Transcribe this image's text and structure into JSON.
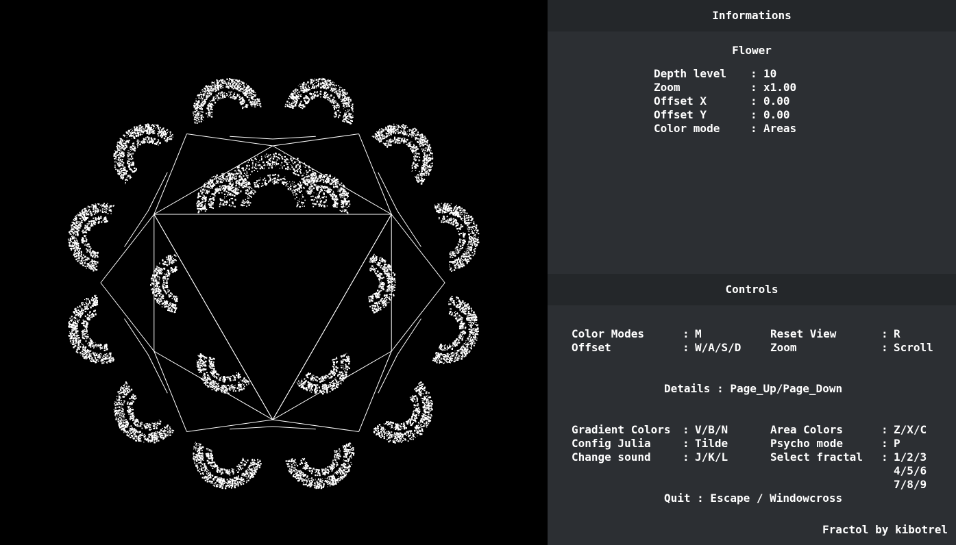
{
  "info": {
    "header": "Informations",
    "fractal_name": "Flower",
    "rows": [
      {
        "label": "Depth level",
        "value": "10"
      },
      {
        "label": "Zoom",
        "value": "x1.00"
      },
      {
        "label": "Offset X",
        "value": "0.00"
      },
      {
        "label": "Offset Y",
        "value": "0.00"
      },
      {
        "label": "Color mode",
        "value": "Areas"
      }
    ]
  },
  "controls": {
    "header": "Controls",
    "left": [
      {
        "label": "Color Modes",
        "keys": "M"
      },
      {
        "label": "Offset",
        "keys": "W/A/S/D"
      }
    ],
    "right": [
      {
        "label": "Reset View",
        "keys": "R"
      },
      {
        "label": "Zoom",
        "keys": "Scroll"
      }
    ],
    "details": "Details : Page_Up/Page_Down",
    "left2": [
      {
        "label": "Gradient Colors",
        "keys": "V/B/N"
      },
      {
        "label": "Config Julia",
        "keys": "Tilde"
      },
      {
        "label": "Change sound",
        "keys": "J/K/L"
      }
    ],
    "right2": [
      {
        "label": "Area Colors",
        "keys": "Z/X/C"
      },
      {
        "label": "Psycho mode",
        "keys": "P"
      },
      {
        "label": "Select fractal",
        "keys": "1/2/3"
      }
    ],
    "select_more": [
      "4/5/6",
      "7/8/9"
    ],
    "quit": "Quit : Escape / Windowcross"
  },
  "credit": "Fractol by kibotrel",
  "colors": {
    "panel_bg": "#2c2f33",
    "header_bg": "#24272a",
    "fractal": "#ffffff",
    "canvas_bg": "#000000"
  }
}
